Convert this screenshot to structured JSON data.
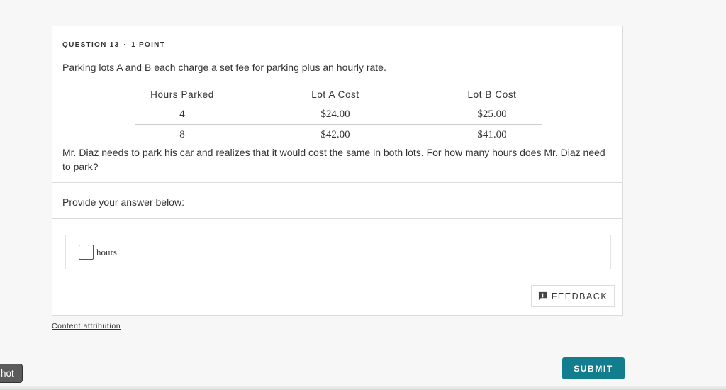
{
  "question": {
    "number_label": "QUESTION 13",
    "separator": "·",
    "points_label": "1 POINT",
    "prompt": "Parking lots A and B each charge a set fee for parking plus an hourly rate.",
    "text": "Mr. Diaz needs to park his car and realizes that it would cost the same in both lots. For how many hours does Mr. Diaz need to park?"
  },
  "table": {
    "headers": [
      "Hours Parked",
      "Lot A Cost",
      "Lot B Cost"
    ],
    "rows": [
      [
        "4",
        "$24.00",
        "$25.00"
      ],
      [
        "8",
        "$42.00",
        "$41.00"
      ]
    ]
  },
  "answer": {
    "label": "Provide your answer below:",
    "value": "",
    "unit": "hours"
  },
  "feedback": {
    "label": "FEEDBACK",
    "icon": "feedback-icon"
  },
  "attribution": {
    "label": "Content attribution"
  },
  "submit": {
    "label": "SUBMIT",
    "color": "#127d8c"
  },
  "side_tab": {
    "label": "hot"
  }
}
